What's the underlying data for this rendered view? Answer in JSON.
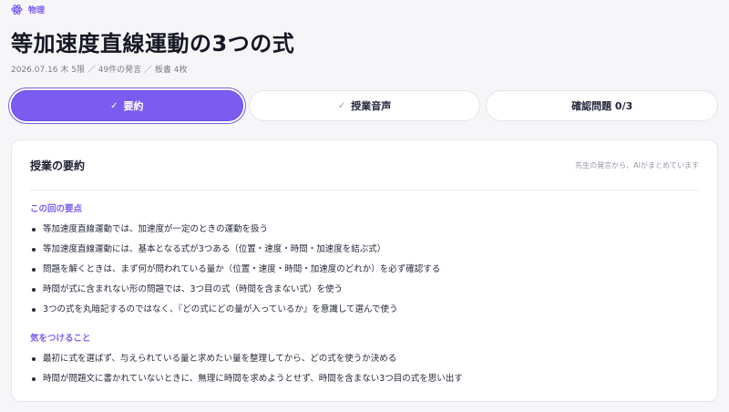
{
  "header": {
    "subject_icon": "atom-icon",
    "subject": "物理",
    "title": "等加速度直線運動の3つの式",
    "meta": "2026.07.16 木 5限 ／ 49件の発言 ／ 板書 4枚"
  },
  "tabs": [
    {
      "label": "要約",
      "check_icon": "check-icon",
      "check": "✓",
      "active": true
    },
    {
      "label": "授業音声",
      "check_icon": "check-icon",
      "check": "✓",
      "active": false
    },
    {
      "label": "確認問題 0/3",
      "active": false
    }
  ],
  "summary": {
    "title": "授業の要約",
    "note": "先生の発言から、AIがまとめています",
    "key_points": {
      "heading": "この回の要点",
      "items": [
        "等加速度直線運動では、加速度が一定のときの運動を扱う",
        "等加速度直線運動には、基本となる式が3つある（位置・速度・時間・加速度を結ぶ式）",
        "問題を解くときは、まず何が問われている量か（位置・速度・時間・加速度のどれか）を必ず確認する",
        "時間が式に含まれない形の問題では、3つ目の式（時間を含まない式）を使う",
        "3つの式を丸暗記するのではなく、『どの式にどの量が入っているか』を意識して選んで使う"
      ]
    },
    "cautions": {
      "heading": "気をつけること",
      "items": [
        "最初に式を選ばず、与えられている量と求めたい量を整理してから、どの式を使うか決める",
        "時間が問題文に書かれていないときに、無理に時間を求めようとせず、時間を含まない3つ目の式を思い出す"
      ]
    }
  },
  "colors": {
    "accent": "#7b5cf0",
    "background": "#f6f6f8"
  }
}
